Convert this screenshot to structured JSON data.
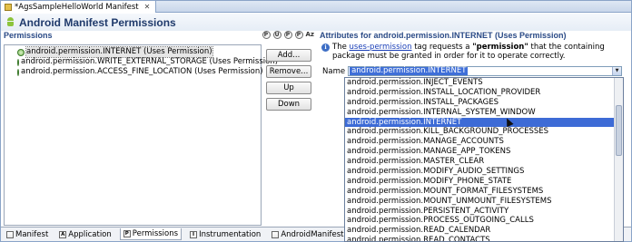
{
  "editor": {
    "tab_title": "*AgsSampleHelloWorld Manifest",
    "tab_close": "✕"
  },
  "header": {
    "title": "Android Manifest Permissions"
  },
  "permissions": {
    "section_title": "Permissions",
    "sort_icons": [
      "P",
      "U",
      "P",
      "P"
    ],
    "sort_az": "Az",
    "items": [
      "android.permission.INTERNET (Uses Permission)",
      "android.permission.WRITE_EXTERNAL_STORAGE (Uses Permission)",
      "android.permission.ACCESS_FINE_LOCATION (Uses Permission)"
    ],
    "selected_index": 0,
    "buttons": {
      "add": "Add...",
      "remove": "Remove...",
      "up": "Up",
      "down": "Down"
    }
  },
  "attributes": {
    "section_title": "Attributes for android.permission.INTERNET (Uses Permission)",
    "info_prefix": "The",
    "info_link": "uses-permission",
    "info_middle": "tag requests a",
    "info_bold": "\"permission\"",
    "info_suffix": "that the containing package must be granted in order for it to operate correctly.",
    "name_label": "Name",
    "name_value": "android.permission.INTERNET",
    "dropdown_options": [
      "android.permission.INJECT_EVENTS",
      "android.permission.INSTALL_LOCATION_PROVIDER",
      "android.permission.INSTALL_PACKAGES",
      "android.permission.INTERNAL_SYSTEM_WINDOW",
      "android.permission.INTERNET",
      "android.permission.KILL_BACKGROUND_PROCESSES",
      "android.permission.MANAGE_ACCOUNTS",
      "android.permission.MANAGE_APP_TOKENS",
      "android.permission.MASTER_CLEAR",
      "android.permission.MODIFY_AUDIO_SETTINGS",
      "android.permission.MODIFY_PHONE_STATE",
      "android.permission.MOUNT_FORMAT_FILESYSTEMS",
      "android.permission.MOUNT_UNMOUNT_FILESYSTEMS",
      "android.permission.PERSISTENT_ACTIVITY",
      "android.permission.PROCESS_OUTGOING_CALLS",
      "android.permission.READ_CALENDAR",
      "android.permission.READ_CONTACTS"
    ],
    "highlighted_index": 4
  },
  "bottom_tabs": [
    {
      "icon": "",
      "label": "Manifest",
      "active": false
    },
    {
      "icon": "A",
      "label": "Application",
      "active": false
    },
    {
      "icon": "P",
      "label": "Permissions",
      "active": true
    },
    {
      "icon": "I",
      "label": "Instrumentation",
      "active": false
    },
    {
      "icon": "",
      "label": "AndroidManifest.xml",
      "active": false
    }
  ]
}
